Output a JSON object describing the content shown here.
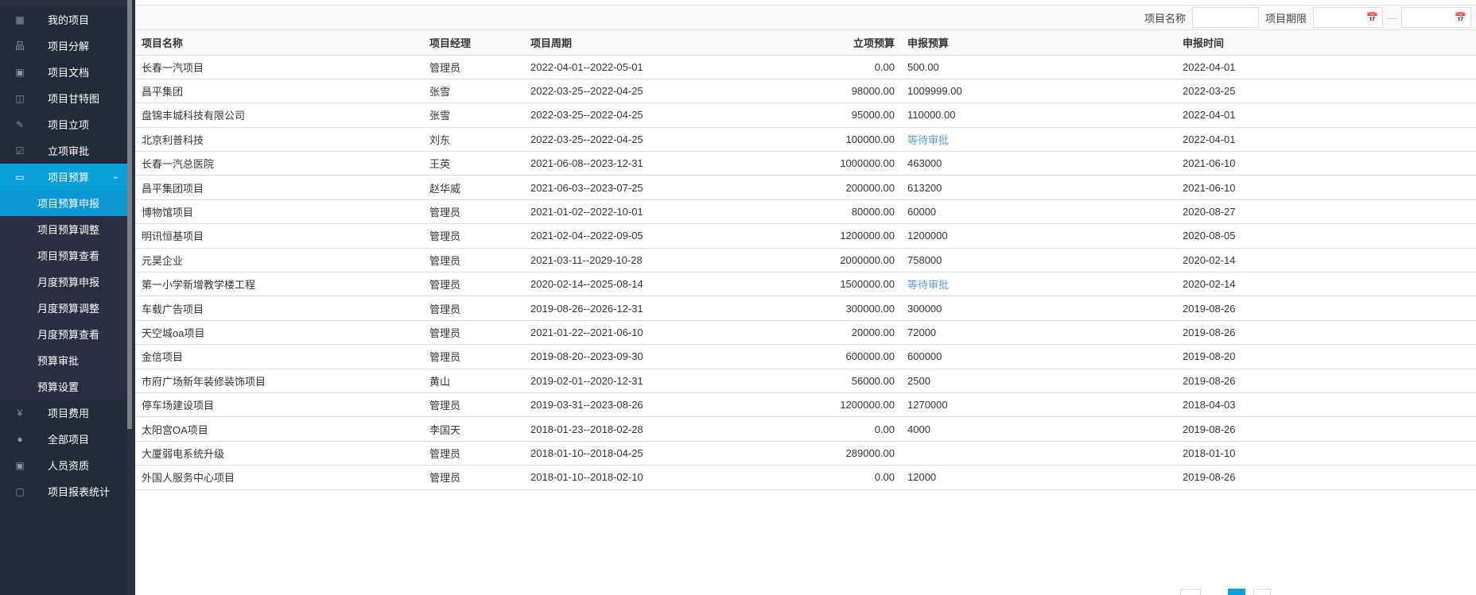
{
  "sidebar": {
    "items": [
      {
        "label": "我的项目",
        "icon": "grid-icon"
      },
      {
        "label": "项目分解",
        "icon": "sitemap-icon"
      },
      {
        "label": "项目文档",
        "icon": "chart-icon"
      },
      {
        "label": "项目甘特图",
        "icon": "gantt-icon"
      },
      {
        "label": "项目立项",
        "icon": "pencil-icon"
      },
      {
        "label": "立项审批",
        "icon": "checkbox-icon"
      },
      {
        "label": "项目预算",
        "icon": "monitor-icon"
      }
    ],
    "sub_items": [
      {
        "label": "项目预算申报"
      },
      {
        "label": "项目预算调整"
      },
      {
        "label": "项目预算查看"
      },
      {
        "label": "月度预算申报"
      },
      {
        "label": "月度预算调整"
      },
      {
        "label": "月度预算查看"
      },
      {
        "label": "预算审批"
      },
      {
        "label": "预算设置"
      }
    ],
    "items_after": [
      {
        "label": "项目费用",
        "icon": "yen-file-icon"
      },
      {
        "label": "全部项目",
        "icon": "globe-icon"
      },
      {
        "label": "人员资质",
        "icon": "chart-icon"
      },
      {
        "label": "项目报表统计",
        "icon": "report-icon"
      }
    ]
  },
  "filter": {
    "name_label": "项目名称",
    "name_value": "",
    "period_label": "项目期限",
    "start_value": "",
    "end_value": "",
    "separator": "—"
  },
  "table": {
    "headers": [
      "项目名称",
      "项目经理",
      "项目周期",
      "立项预算",
      "申报预算",
      "申报时间"
    ],
    "rows": [
      [
        "长春一汽项目",
        "管理员",
        "2022-04-01--2022-05-01",
        "0.00",
        "500.00",
        "2022-04-01"
      ],
      [
        "昌平集团",
        "张雪",
        "2022-03-25--2022-04-25",
        "98000.00",
        "1009999.00",
        "2022-03-25"
      ],
      [
        "盘锦丰城科技有限公司",
        "张雪",
        "2022-03-25--2022-04-25",
        "95000.00",
        "110000.00",
        "2022-04-01"
      ],
      [
        "北京利普科技",
        "刘东",
        "2022-03-25--2022-04-25",
        "100000.00",
        "等待审批",
        "2022-04-01"
      ],
      [
        "长春一汽总医院",
        "王英",
        "2021-06-08--2023-12-31",
        "1000000.00",
        "463000",
        "2021-06-10"
      ],
      [
        "昌平集团项目",
        "赵华威",
        "2021-06-03--2023-07-25",
        "200000.00",
        "613200",
        "2021-06-10"
      ],
      [
        "博物馆项目",
        "管理员",
        "2021-01-02--2022-10-01",
        "80000.00",
        "60000",
        "2020-08-27"
      ],
      [
        "明讯恒基项目",
        "管理员",
        "2021-02-04--2022-09-05",
        "1200000.00",
        "1200000",
        "2020-08-05"
      ],
      [
        "元昊企业",
        "管理员",
        "2021-03-11--2029-10-28",
        "2000000.00",
        "758000",
        "2020-02-14"
      ],
      [
        "第一小学新增教学楼工程",
        "管理员",
        "2020-02-14--2025-08-14",
        "1500000.00",
        "等待审批",
        "2020-02-14"
      ],
      [
        "车载广告项目",
        "管理员",
        "2019-08-26--2026-12-31",
        "300000.00",
        "300000",
        "2019-08-26"
      ],
      [
        "天空城oa项目",
        "管理员",
        "2021-01-22--2021-06-10",
        "20000.00",
        "72000",
        "2019-08-26"
      ],
      [
        "金信项目",
        "管理员",
        "2019-08-20--2023-09-30",
        "600000.00",
        "600000",
        "2019-08-20"
      ],
      [
        "市府广场新年装修装饰项目",
        "黄山",
        "2019-02-01--2020-12-31",
        "56000.00",
        "2500",
        "2019-08-26"
      ],
      [
        "停车场建设项目",
        "管理员",
        "2019-03-31--2023-08-26",
        "1200000.00",
        "1270000",
        "2018-04-03"
      ],
      [
        "太阳宫OA项目",
        "李国天",
        "2018-01-23--2018-02-28",
        "0.00",
        "4000",
        "2019-08-26"
      ],
      [
        "大厦弱电系统升级",
        "管理员",
        "2018-01-10--2018-04-25",
        "289000.00",
        "",
        "2018-01-10"
      ],
      [
        "外国人服务中心项目",
        "管理员",
        "2018-01-10--2018-02-10",
        "0.00",
        "12000",
        "2019-08-26"
      ]
    ]
  },
  "colors": {
    "sidebar": "#222b38",
    "active": "#0aa0dc",
    "pending": "#5b9bd1"
  }
}
